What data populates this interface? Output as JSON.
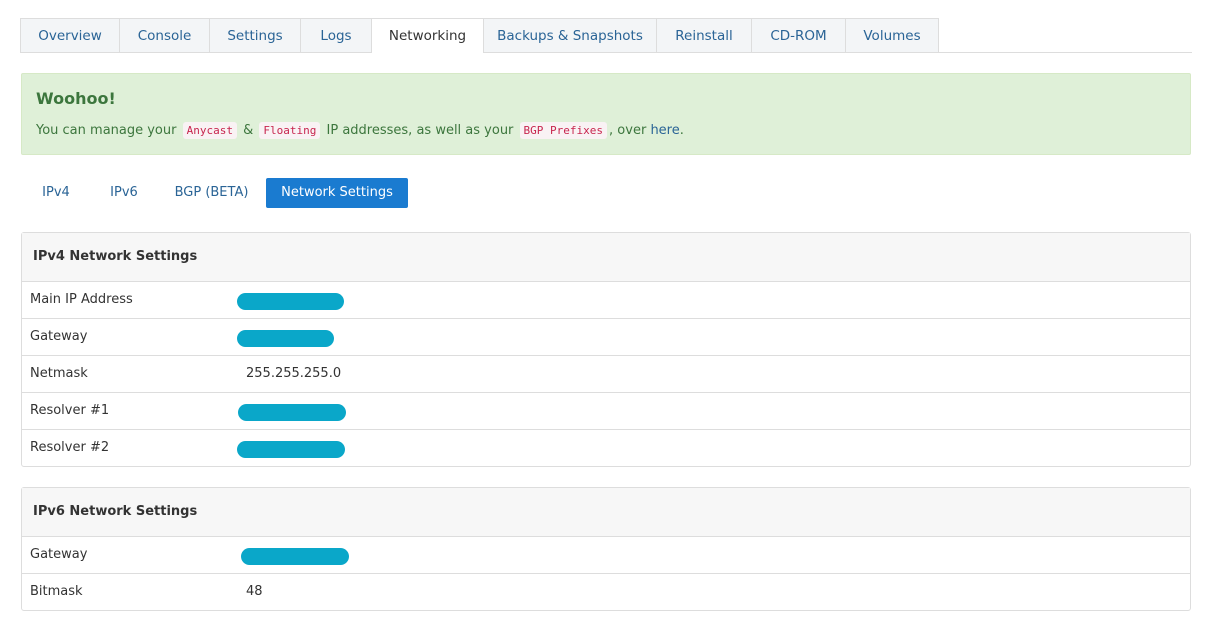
{
  "tabs": [
    {
      "label": "Overview"
    },
    {
      "label": "Console"
    },
    {
      "label": "Settings"
    },
    {
      "label": "Logs"
    },
    {
      "label": "Networking",
      "active": true
    },
    {
      "label": "Backups & Snapshots"
    },
    {
      "label": "Reinstall"
    },
    {
      "label": "CD-ROM"
    },
    {
      "label": "Volumes"
    }
  ],
  "alert": {
    "title": "Woohoo!",
    "text_before": "You can manage your",
    "code_anycast": "Anycast",
    "amp": "&",
    "code_floating": "Floating",
    "text_mid": "IP addresses, as well as your",
    "code_bgp": "BGP Prefixes",
    "text_over": ", over",
    "link": "here",
    "period": "."
  },
  "pills": [
    {
      "label": "IPv4"
    },
    {
      "label": "IPv6"
    },
    {
      "label": "BGP (BETA)"
    },
    {
      "label": "Network Settings",
      "active": true
    }
  ],
  "ipv4": {
    "title": "IPv4 Network Settings",
    "rows": [
      {
        "label": "Main IP Address",
        "value": null,
        "redacted": true
      },
      {
        "label": "Gateway",
        "value": null,
        "redacted": true
      },
      {
        "label": "Netmask",
        "value": "255.255.255.0"
      },
      {
        "label": "Resolver #1",
        "value": null,
        "redacted": true
      },
      {
        "label": "Resolver #2",
        "value": null,
        "redacted": true
      }
    ]
  },
  "ipv6": {
    "title": "IPv6 Network Settings",
    "rows": [
      {
        "label": "Gateway",
        "value": null,
        "redacted": true
      },
      {
        "label": "Bitmask",
        "value": "48"
      }
    ]
  },
  "colors": {
    "accent": "#1a7bd0",
    "link": "#2a6496",
    "redaction": "#0aa7c9",
    "alert_bg": "#dff0d8",
    "alert_text": "#3c763d"
  }
}
